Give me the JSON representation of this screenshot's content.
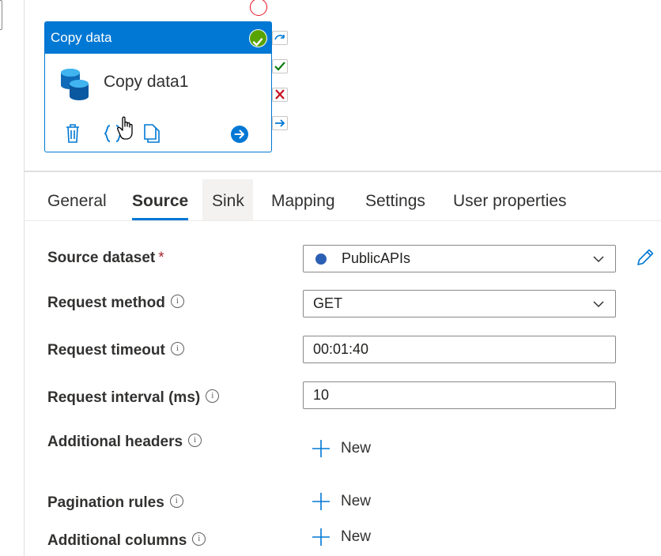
{
  "activity": {
    "type_label": "Copy data",
    "name": "Copy data1",
    "icons": [
      "delete-icon",
      "code-icon",
      "copy-icon",
      "go-icon",
      "success-check-icon"
    ]
  },
  "side_buttons": [
    "skip-icon",
    "success-icon",
    "failure-icon",
    "completion-icon"
  ],
  "tabs": [
    {
      "label": "General"
    },
    {
      "label": "Source"
    },
    {
      "label": "Sink"
    },
    {
      "label": "Mapping"
    },
    {
      "label": "Settings"
    },
    {
      "label": "User properties"
    }
  ],
  "active_tab": "Source",
  "form": {
    "source_dataset": {
      "label": "Source dataset",
      "required_mark": "*",
      "value": "PublicAPIs"
    },
    "request_method": {
      "label": "Request method",
      "value": "GET"
    },
    "request_timeout": {
      "label": "Request timeout",
      "value": "00:01:40"
    },
    "request_interval": {
      "label": "Request interval (ms)",
      "value": "10"
    },
    "additional_headers": {
      "label": "Additional headers",
      "button": "New"
    },
    "pagination_rules": {
      "label": "Pagination rules",
      "button": "New"
    },
    "additional_columns": {
      "label": "Additional columns",
      "button": "New"
    },
    "info_glyph": "i"
  },
  "colors": {
    "accent": "#0078d4",
    "success": "#57a300",
    "failure": "#c50f1f",
    "required": "#a4262c"
  }
}
